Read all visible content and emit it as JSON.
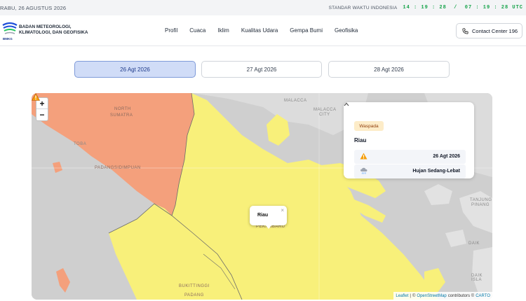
{
  "topbar": {
    "date": "RABU, 26 AGUSTUS 2026",
    "timezone_label": "STANDAR WAKTU INDONESIA",
    "clock": "14 : 19 : 28  /  07 : 19 : 28 UTC"
  },
  "header": {
    "brand_line1": "BADAN METEOROLOGI,",
    "brand_line2": "KLIMATOLOGI, DAN GEOFISIKA",
    "logo_text": "BMKG",
    "nav": [
      "Profil",
      "Cuaca",
      "Iklim",
      "Kualitas Udara",
      "Gempa Bumi",
      "Geofisika"
    ],
    "contact_label": "Contact Center 196"
  },
  "date_tabs": [
    "26 Agt 2026",
    "27 Agt 2026",
    "28 Agt 2026"
  ],
  "active_tab": "26 Agt 2026",
  "map": {
    "zoom_in": "+",
    "zoom_out": "−",
    "labels": {
      "north_sumatra": "NORTH",
      "north_sumatra2": "SUMATRA",
      "padangsidimpuan": "PADANGSIDIMPUAN",
      "malacca": "MALACCA",
      "malacca_city": "MALACCA",
      "malacca_city2": "CITY",
      "pekanbaru": "PEKANBARU",
      "bukittinggi": "BUKITTINGGI",
      "padang": "PADANG",
      "toba": "TOBA",
      "tanjung_pinang": "TANJUNG",
      "tanjung_pinang2": "PINANG",
      "daik": "DAIK",
      "daik2": "DAIK ISLA"
    },
    "colors": {
      "warning_yellow": "#f8f07a",
      "alert_orange": "#f4a07c",
      "land_gray": "#d6d6d6",
      "sea": "#c8c8c8"
    },
    "popup_title": "Riau",
    "popup_close": "×"
  },
  "info_panel": {
    "status": "Waspada",
    "region": "Riau",
    "date": "26 Agt 2026",
    "weather": "Hujan Sedang-Lebat"
  },
  "attribution": {
    "leaflet": "Leaflet",
    "sep": "|",
    "copy": "©",
    "osm": "OpenStreetMap",
    "contributors": "contributors ©",
    "carto": "CARTO"
  }
}
